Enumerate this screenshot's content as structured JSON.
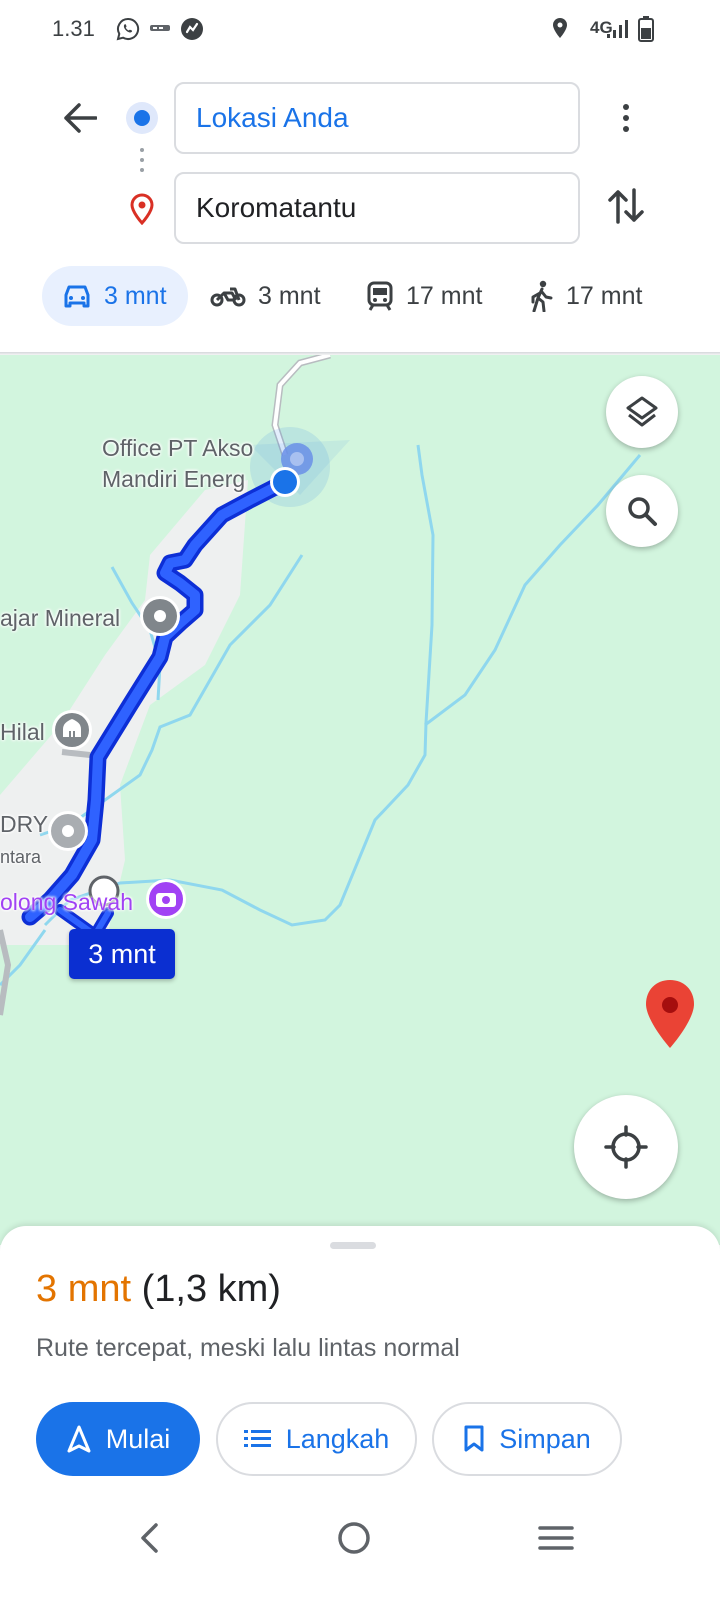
{
  "status_bar": {
    "time": "1.31",
    "network": "4G",
    "icons": [
      "whatsapp-icon",
      "carrier-badge-icon",
      "app-icon",
      "location-icon",
      "signal-icon",
      "battery-icon"
    ]
  },
  "directions": {
    "origin": "Lokasi Anda",
    "destination": "Koromatantu"
  },
  "modes": [
    {
      "label": "3 mnt",
      "icon": "car-icon",
      "active": true
    },
    {
      "label": "3 mnt",
      "icon": "motorcycle-icon",
      "active": false
    },
    {
      "label": "17 mnt",
      "icon": "transit-icon",
      "active": false
    },
    {
      "label": "17 mnt",
      "icon": "walk-icon",
      "active": false
    }
  ],
  "map": {
    "places": [
      {
        "line1": "Office PT Akso",
        "line2": "Mandiri Energ"
      },
      {
        "line1": "ajar Mineral"
      },
      {
        "line1": "Hilal"
      },
      {
        "line1": "DRY",
        "line2": "ntara"
      },
      {
        "line1": "olong Sawah"
      }
    ],
    "route_badge": "3 mnt"
  },
  "summary": {
    "duration": "3 mnt",
    "distance": "(1,3 km)",
    "description": "Rute tercepat, meski lalu lintas normal"
  },
  "actions": {
    "start": "Mulai",
    "steps": "Langkah",
    "save": "Simpan"
  },
  "colors": {
    "accent": "#1a73e8",
    "route": "#1234e0",
    "map_background": "#d2f5de",
    "duration": "#e37400",
    "destination_pin": "#ea4335"
  }
}
